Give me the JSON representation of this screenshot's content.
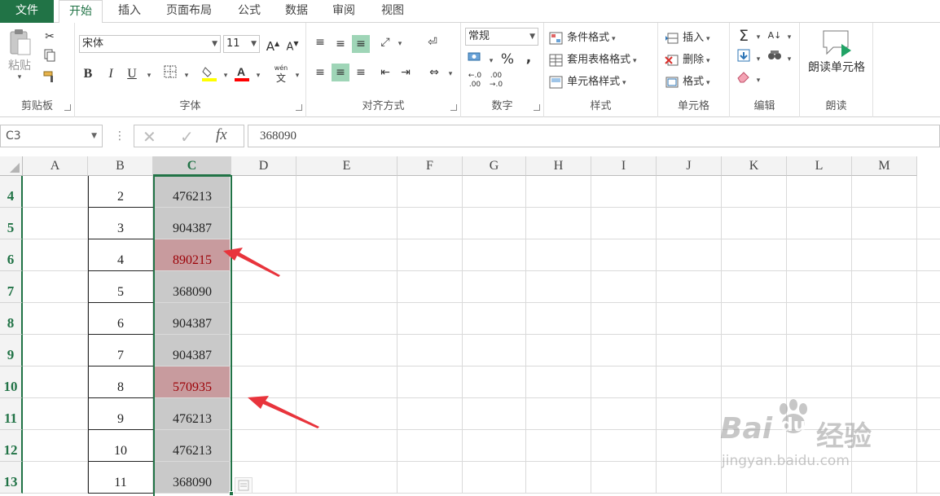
{
  "tabs": {
    "file": "文件",
    "items": [
      "开始",
      "插入",
      "页面布局",
      "公式",
      "数据",
      "审阅",
      "视图"
    ]
  },
  "ribbon": {
    "clipboard": {
      "label": "剪贴板",
      "paste": "粘贴"
    },
    "font": {
      "label": "字体",
      "name": "宋体",
      "size": "11",
      "grow": "A",
      "shrink": "A",
      "bold": "B",
      "italic": "I",
      "underline": "U",
      "phonetic_top": "wén",
      "phonetic": "文"
    },
    "align": {
      "label": "对齐方式"
    },
    "number": {
      "label": "数字",
      "format": "常规",
      "percent": "%",
      "comma": ",",
      "inc_decimal_a": "←.0",
      "inc_decimal_b": ".00",
      "dec_decimal_a": ".00",
      "dec_decimal_b": "→.0"
    },
    "styles": {
      "label": "样式",
      "conditional": "条件格式",
      "table": "套用表格格式",
      "cell": "单元格样式"
    },
    "cells": {
      "label": "单元格",
      "insert": "插入",
      "delete": "删除",
      "format": "格式"
    },
    "editing": {
      "label": "编辑"
    },
    "read": {
      "label": "朗读",
      "button": "朗读单元格"
    }
  },
  "formula_bar": {
    "name_box": "C3",
    "fx": "fx",
    "value": "368090"
  },
  "columns": [
    "A",
    "B",
    "C",
    "D",
    "E",
    "F",
    "G",
    "H",
    "I",
    "J",
    "K",
    "L",
    "M"
  ],
  "selected_column": "C",
  "rows": [
    {
      "num": "4",
      "b": "2",
      "c": "476213",
      "highlight": false
    },
    {
      "num": "5",
      "b": "3",
      "c": "904387",
      "highlight": false
    },
    {
      "num": "6",
      "b": "4",
      "c": "890215",
      "highlight": true
    },
    {
      "num": "7",
      "b": "5",
      "c": "368090",
      "highlight": false
    },
    {
      "num": "8",
      "b": "6",
      "c": "904387",
      "highlight": false
    },
    {
      "num": "9",
      "b": "7",
      "c": "904387",
      "highlight": false
    },
    {
      "num": "10",
      "b": "8",
      "c": "570935",
      "highlight": true
    },
    {
      "num": "11",
      "b": "9",
      "c": "476213",
      "highlight": false
    },
    {
      "num": "12",
      "b": "10",
      "c": "476213",
      "highlight": false
    },
    {
      "num": "13",
      "b": "11",
      "c": "368090",
      "highlight": false
    }
  ],
  "colors": {
    "accent": "#217346",
    "highlight_fill": "#c89b9e",
    "highlight_text": "#9c0006",
    "selected_fill": "#c9c9c9",
    "arrow": "#e8343c"
  },
  "watermark": {
    "brand": "Bai",
    "brand2": "du",
    "cn": "经验",
    "url": "jingyan.baidu.com"
  }
}
